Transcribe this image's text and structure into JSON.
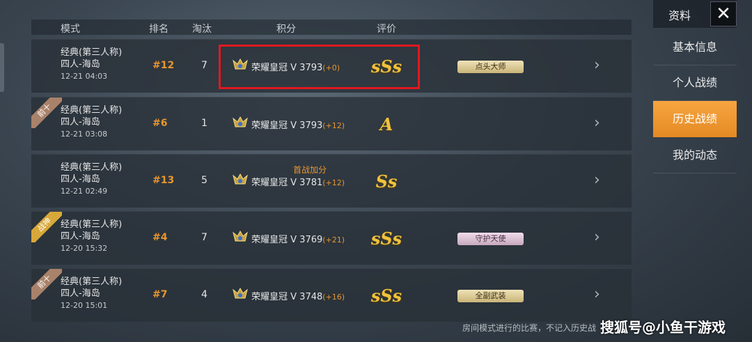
{
  "header": {
    "mode": "模式",
    "rank": "排名",
    "elim": "淘汰",
    "score": "积分",
    "grade": "评价"
  },
  "rows": [
    {
      "mode": "经典(第三人称)",
      "map": "四人-海岛",
      "time": "12-21 04:03",
      "rank": "#12",
      "elim": "7",
      "tier": "荣耀皇冠 V",
      "score": "3793",
      "delta": "(+0)",
      "grade": "sSs",
      "badge": "点头大师",
      "badge_style": "gold",
      "ribbon": "",
      "bonus": ""
    },
    {
      "mode": "经典(第三人称)",
      "map": "四人-海岛",
      "time": "12-21 03:08",
      "rank": "#6",
      "elim": "1",
      "tier": "荣耀皇冠 V",
      "score": "3793",
      "delta": "(+12)",
      "grade": "A",
      "badge": "",
      "ribbon": "前十",
      "ribbon_style": "gray",
      "bonus": ""
    },
    {
      "mode": "经典(第三人称)",
      "map": "四人-海岛",
      "time": "12-21 02:49",
      "rank": "#13",
      "elim": "5",
      "tier": "荣耀皇冠 V",
      "score": "3781",
      "delta": "(+12)",
      "grade": "Ss",
      "badge": "",
      "ribbon": "",
      "bonus": "首战加分"
    },
    {
      "mode": "经典(第三人称)",
      "map": "四人-海岛",
      "time": "12-20 15:32",
      "rank": "#4",
      "elim": "7",
      "tier": "荣耀皇冠 V",
      "score": "3769",
      "delta": "(+21)",
      "grade": "sSs",
      "badge": "守护天使",
      "badge_style": "pink",
      "ribbon": "战神",
      "ribbon_style": "gold",
      "bonus": ""
    },
    {
      "mode": "经典(第三人称)",
      "map": "四人-海岛",
      "time": "12-20 15:01",
      "rank": "#7",
      "elim": "4",
      "tier": "荣耀皇冠 V",
      "score": "3748",
      "delta": "(+16)",
      "grade": "sSs",
      "badge": "全副武装",
      "badge_style": "gold",
      "ribbon": "前十",
      "ribbon_style": "gray",
      "bonus": ""
    }
  ],
  "sidebar": {
    "title": "资料",
    "close_icon": "close-icon",
    "items": [
      {
        "label": "基本信息",
        "active": false
      },
      {
        "label": "个人战绩",
        "active": false
      },
      {
        "label": "历史战绩",
        "active": true
      },
      {
        "label": "我的动态",
        "active": false
      }
    ]
  },
  "footer_note": "房间模式进行的比赛，不记入历史战",
  "watermark": "搜狐号@小鱼干游戏",
  "colors": {
    "accent": "#f7a540",
    "rank": "#e8962f",
    "grade": "#f0c23c",
    "highlight": "#e0181f"
  }
}
